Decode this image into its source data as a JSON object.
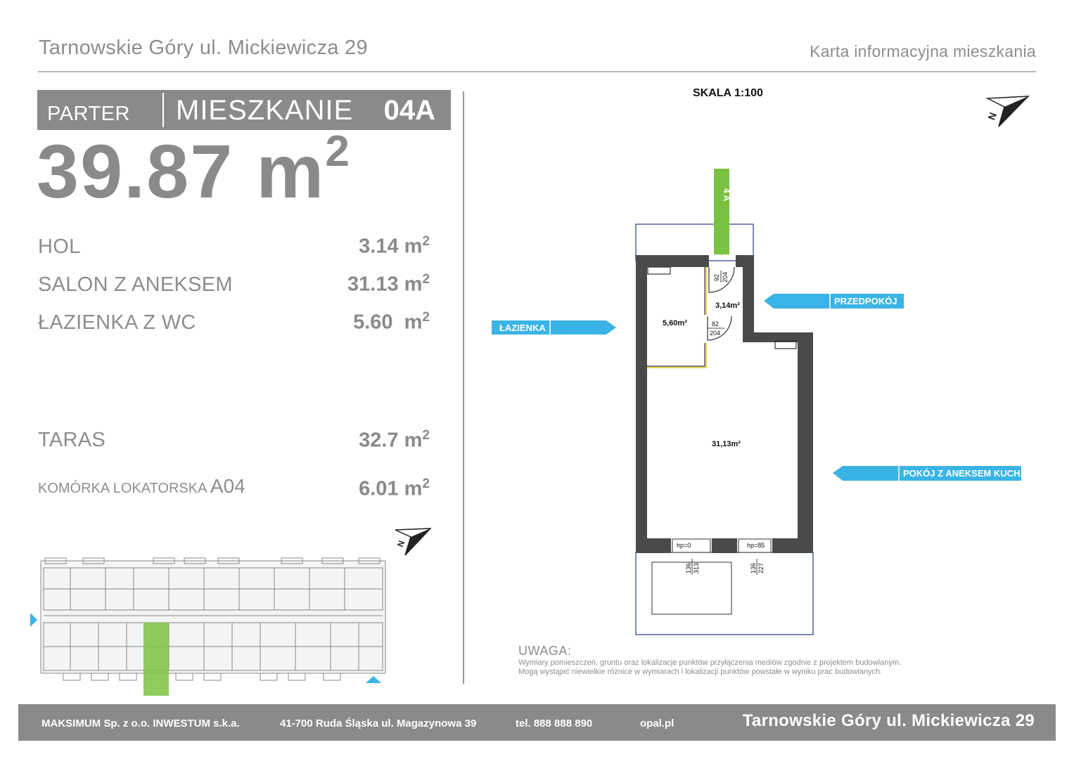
{
  "header": {
    "location": "Tarnowskie Góry ul. Mickiewicza 29",
    "document_type": "Karta informacyjna mieszkania"
  },
  "apartment": {
    "floor": "PARTER",
    "label": "MIESZKANIE",
    "number": "04A",
    "total_area": "39.87 m",
    "total_area_sup": "2"
  },
  "rooms": [
    {
      "name": "HOL",
      "area": "3.14 m",
      "sup": "2"
    },
    {
      "name": "SALON Z ANEKSEM",
      "area": "31.13 m",
      "sup": "2"
    },
    {
      "name": "ŁAZIENKA Z WC",
      "area": "5.60  m",
      "sup": "2"
    }
  ],
  "extras": {
    "terrace_name": "TARAS",
    "terrace_area": "32.7 m",
    "terrace_sup": "2",
    "storage_name": "KOMÓRKA LOKATORSKA",
    "storage_code": "A04",
    "storage_area": "6.01 m",
    "storage_sup": "2"
  },
  "plan": {
    "scale": "SKALA 1:100",
    "unit_tag": "4 A",
    "callouts": [
      "ŁAZIENKA",
      "PRZEDPOKÓJ",
      "POKÓJ Z ANEKSEM KUCH."
    ],
    "room_areas": [
      "5,60m²",
      "3,14m²",
      "31,13m²"
    ],
    "doors": [
      {
        "width": "92",
        "height": "204"
      },
      {
        "width": "82",
        "height": "204"
      }
    ],
    "windows": [
      {
        "hp": "hp=0",
        "width": "136",
        "height": "313"
      },
      {
        "hp": "hp=85",
        "width": "136",
        "height": "227"
      }
    ]
  },
  "note": {
    "title": "UWAGA:",
    "line1": "Wymiary pomieszczeń, gruntu oraz lokalizacje punktów przyłączenia mediów zgodnie z projektem budowlanym.",
    "line2": "Mogą wystąpić niewielkie różnice w wymiarach i lokalizacji punktów powstałe w wyniku prac budowlanych."
  },
  "footer": {
    "company": "MAKSIMUM Sp. z o.o. INWESTUM s.k.a.",
    "address": "41-700 Ruda Śląska ul. Magazynowa 39",
    "phone": "tel. 888 888 890",
    "website": "opal.pl",
    "location": "Tarnowskie Góry ul. Mickiewicza 29"
  },
  "colors": {
    "grey": "#8a8a8a",
    "wall": "#4a4a4a",
    "callout_blue": "#3ab4e6",
    "unit_green": "#7cc242",
    "bath_wall": "#e8d44d"
  },
  "icons": [
    "north-arrow-icon"
  ]
}
